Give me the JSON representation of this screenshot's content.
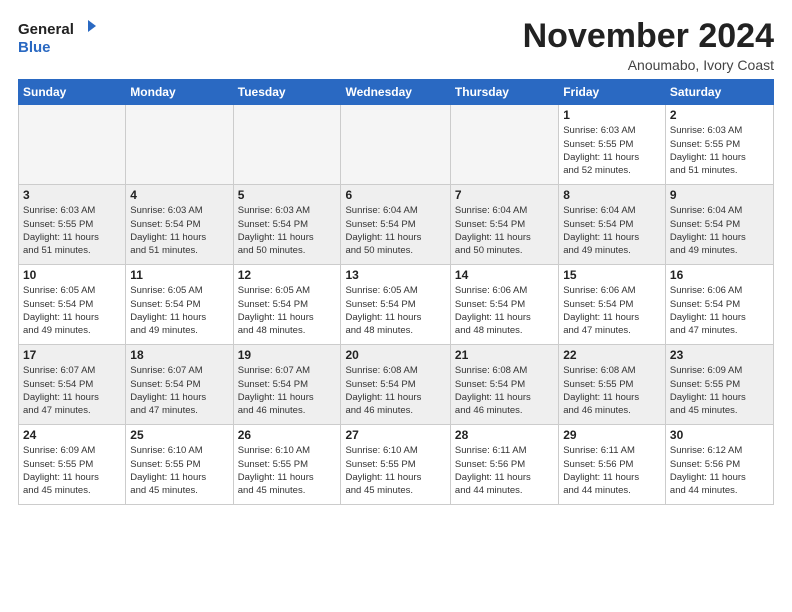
{
  "header": {
    "logo_line1": "General",
    "logo_line2": "Blue",
    "month": "November 2024",
    "location": "Anoumabo, Ivory Coast"
  },
  "weekdays": [
    "Sunday",
    "Monday",
    "Tuesday",
    "Wednesday",
    "Thursday",
    "Friday",
    "Saturday"
  ],
  "weeks": [
    [
      {
        "day": "",
        "info": ""
      },
      {
        "day": "",
        "info": ""
      },
      {
        "day": "",
        "info": ""
      },
      {
        "day": "",
        "info": ""
      },
      {
        "day": "",
        "info": ""
      },
      {
        "day": "1",
        "info": "Sunrise: 6:03 AM\nSunset: 5:55 PM\nDaylight: 11 hours\nand 52 minutes."
      },
      {
        "day": "2",
        "info": "Sunrise: 6:03 AM\nSunset: 5:55 PM\nDaylight: 11 hours\nand 51 minutes."
      }
    ],
    [
      {
        "day": "3",
        "info": "Sunrise: 6:03 AM\nSunset: 5:55 PM\nDaylight: 11 hours\nand 51 minutes."
      },
      {
        "day": "4",
        "info": "Sunrise: 6:03 AM\nSunset: 5:54 PM\nDaylight: 11 hours\nand 51 minutes."
      },
      {
        "day": "5",
        "info": "Sunrise: 6:03 AM\nSunset: 5:54 PM\nDaylight: 11 hours\nand 50 minutes."
      },
      {
        "day": "6",
        "info": "Sunrise: 6:04 AM\nSunset: 5:54 PM\nDaylight: 11 hours\nand 50 minutes."
      },
      {
        "day": "7",
        "info": "Sunrise: 6:04 AM\nSunset: 5:54 PM\nDaylight: 11 hours\nand 50 minutes."
      },
      {
        "day": "8",
        "info": "Sunrise: 6:04 AM\nSunset: 5:54 PM\nDaylight: 11 hours\nand 49 minutes."
      },
      {
        "day": "9",
        "info": "Sunrise: 6:04 AM\nSunset: 5:54 PM\nDaylight: 11 hours\nand 49 minutes."
      }
    ],
    [
      {
        "day": "10",
        "info": "Sunrise: 6:05 AM\nSunset: 5:54 PM\nDaylight: 11 hours\nand 49 minutes."
      },
      {
        "day": "11",
        "info": "Sunrise: 6:05 AM\nSunset: 5:54 PM\nDaylight: 11 hours\nand 49 minutes."
      },
      {
        "day": "12",
        "info": "Sunrise: 6:05 AM\nSunset: 5:54 PM\nDaylight: 11 hours\nand 48 minutes."
      },
      {
        "day": "13",
        "info": "Sunrise: 6:05 AM\nSunset: 5:54 PM\nDaylight: 11 hours\nand 48 minutes."
      },
      {
        "day": "14",
        "info": "Sunrise: 6:06 AM\nSunset: 5:54 PM\nDaylight: 11 hours\nand 48 minutes."
      },
      {
        "day": "15",
        "info": "Sunrise: 6:06 AM\nSunset: 5:54 PM\nDaylight: 11 hours\nand 47 minutes."
      },
      {
        "day": "16",
        "info": "Sunrise: 6:06 AM\nSunset: 5:54 PM\nDaylight: 11 hours\nand 47 minutes."
      }
    ],
    [
      {
        "day": "17",
        "info": "Sunrise: 6:07 AM\nSunset: 5:54 PM\nDaylight: 11 hours\nand 47 minutes."
      },
      {
        "day": "18",
        "info": "Sunrise: 6:07 AM\nSunset: 5:54 PM\nDaylight: 11 hours\nand 47 minutes."
      },
      {
        "day": "19",
        "info": "Sunrise: 6:07 AM\nSunset: 5:54 PM\nDaylight: 11 hours\nand 46 minutes."
      },
      {
        "day": "20",
        "info": "Sunrise: 6:08 AM\nSunset: 5:54 PM\nDaylight: 11 hours\nand 46 minutes."
      },
      {
        "day": "21",
        "info": "Sunrise: 6:08 AM\nSunset: 5:54 PM\nDaylight: 11 hours\nand 46 minutes."
      },
      {
        "day": "22",
        "info": "Sunrise: 6:08 AM\nSunset: 5:55 PM\nDaylight: 11 hours\nand 46 minutes."
      },
      {
        "day": "23",
        "info": "Sunrise: 6:09 AM\nSunset: 5:55 PM\nDaylight: 11 hours\nand 45 minutes."
      }
    ],
    [
      {
        "day": "24",
        "info": "Sunrise: 6:09 AM\nSunset: 5:55 PM\nDaylight: 11 hours\nand 45 minutes."
      },
      {
        "day": "25",
        "info": "Sunrise: 6:10 AM\nSunset: 5:55 PM\nDaylight: 11 hours\nand 45 minutes."
      },
      {
        "day": "26",
        "info": "Sunrise: 6:10 AM\nSunset: 5:55 PM\nDaylight: 11 hours\nand 45 minutes."
      },
      {
        "day": "27",
        "info": "Sunrise: 6:10 AM\nSunset: 5:55 PM\nDaylight: 11 hours\nand 45 minutes."
      },
      {
        "day": "28",
        "info": "Sunrise: 6:11 AM\nSunset: 5:56 PM\nDaylight: 11 hours\nand 44 minutes."
      },
      {
        "day": "29",
        "info": "Sunrise: 6:11 AM\nSunset: 5:56 PM\nDaylight: 11 hours\nand 44 minutes."
      },
      {
        "day": "30",
        "info": "Sunrise: 6:12 AM\nSunset: 5:56 PM\nDaylight: 11 hours\nand 44 minutes."
      }
    ]
  ]
}
